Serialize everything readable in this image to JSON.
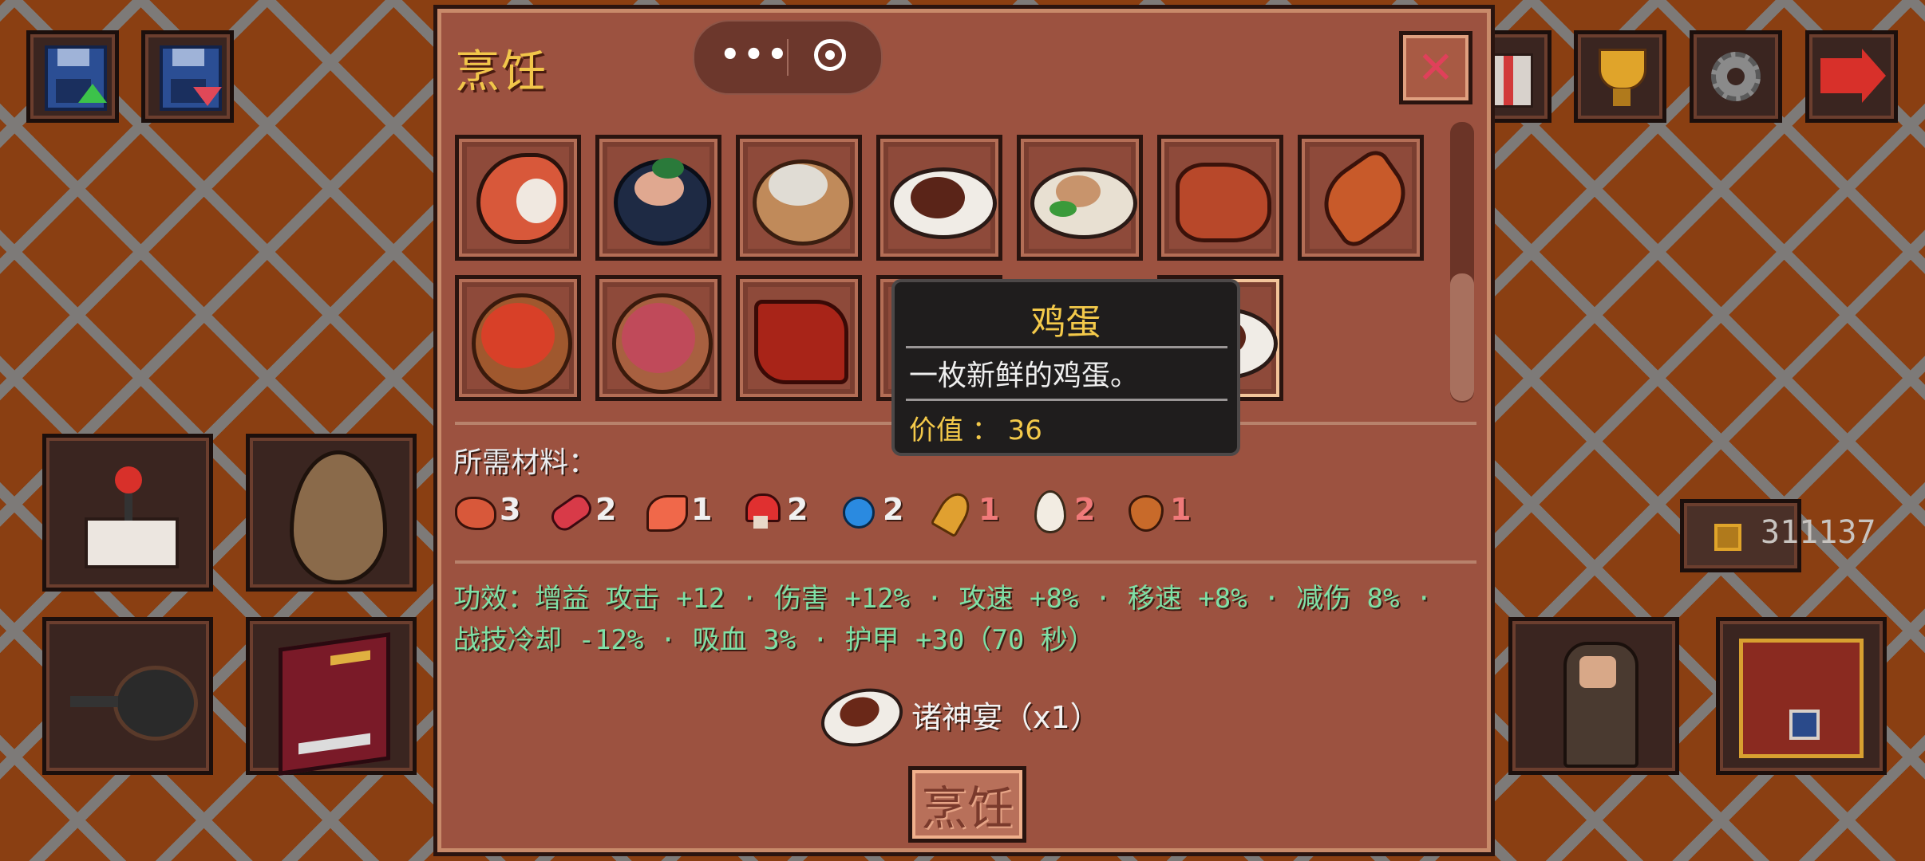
{
  "panel": {
    "title": "烹饪",
    "close_label": "✕",
    "capsule": {
      "more_icon": "more-dots-icon",
      "target_icon": "target-circle-icon"
    }
  },
  "recipes": [
    {
      "name": "shrimp-dish",
      "icon": "shrimp-icon"
    },
    {
      "name": "bowl-dish",
      "icon": "green-bowl-icon"
    },
    {
      "name": "soup-dish",
      "icon": "soup-bowl-icon"
    },
    {
      "name": "steak-plate",
      "icon": "steak-plate-icon"
    },
    {
      "name": "salad-plate",
      "icon": "salad-plate-icon"
    },
    {
      "name": "roast-meat",
      "icon": "roast-meat-icon"
    },
    {
      "name": "grilled-fish",
      "icon": "grilled-fish-icon"
    },
    {
      "name": "tomato-soup",
      "icon": "tomato-soup-icon"
    },
    {
      "name": "berry-pie",
      "icon": "berry-pie-icon"
    },
    {
      "name": "jerky",
      "icon": "jerky-icon"
    },
    {
      "name": "hidden-1",
      "icon": "covered-dish-icon"
    },
    {
      "name": "hidden-2",
      "icon": "covered-dish-icon"
    },
    {
      "name": "feast-plate",
      "icon": "feast-plate-icon"
    }
  ],
  "tooltip": {
    "title": "鸡蛋",
    "description": "一枚新鲜的鸡蛋。",
    "value_label": "价值 ： 36"
  },
  "requirements": {
    "label": "所需材料：",
    "items": [
      {
        "icon": "meat-icon",
        "count": "3",
        "color": "#f0f0f0"
      },
      {
        "icon": "sausage-icon",
        "count": "2",
        "color": "#f0f0f0"
      },
      {
        "icon": "salmon-icon",
        "count": "1",
        "color": "#f0f0f0"
      },
      {
        "icon": "red-mushroom-icon",
        "count": "2",
        "color": "#f0f0f0"
      },
      {
        "icon": "blue-berry-icon",
        "count": "2",
        "color": "#f0f0f0"
      },
      {
        "icon": "wheat-icon",
        "count": "1",
        "color": "#f07a7a"
      },
      {
        "icon": "egg-icon",
        "count": "2",
        "color": "#f07a7a"
      },
      {
        "icon": "onion-icon",
        "count": "1",
        "color": "#f07a7a"
      }
    ]
  },
  "effects": {
    "line1": "功效：增益 攻击 +12 · 伤害 +12% · 攻速 +8% · 移速 +8% · 减伤 8% ·",
    "line2": "战技冷却 -12% · 吸血 3% · 护甲 +30（70 秒）"
  },
  "result": {
    "name": "诸神宴（x1）",
    "icon": "feast-plate-icon"
  },
  "cook_button": "烹饪",
  "hud": {
    "coins": "311137",
    "left_top": [
      "save-up-icon",
      "save-down-icon"
    ],
    "right_top": [
      "gift-icon",
      "trophy-icon",
      "gear-icon",
      "exit-arrow-icon"
    ],
    "left_bottom": [
      "joystick-icon",
      "egg-item-icon",
      "frying-pan-icon",
      "recipe-book-icon"
    ],
    "right_bottom": [
      "merchant-icon",
      "treasure-chest-icon"
    ]
  }
}
